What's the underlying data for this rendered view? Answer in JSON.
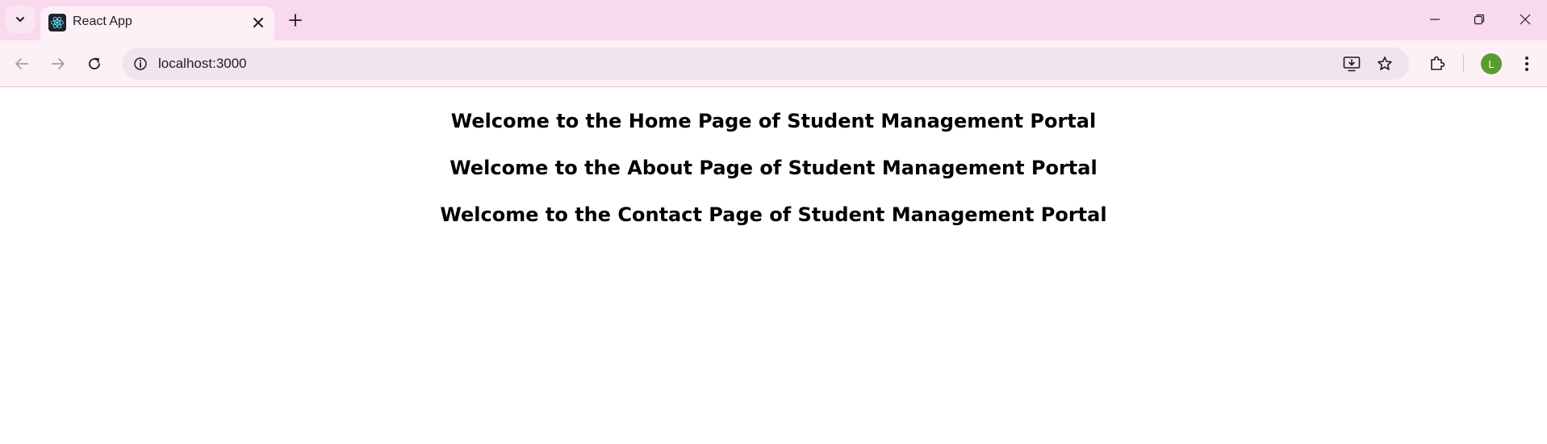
{
  "browser": {
    "tab": {
      "title": "React App"
    },
    "address_bar": {
      "url": "localhost:3000"
    },
    "profile_initial": "L",
    "colors": {
      "tab_strip": "#f8d9ee",
      "toolbar": "#fdf0f7",
      "omnibox": "#f1e4ee",
      "avatar": "#5b9b2f"
    },
    "icons": [
      "tab-search-chevron",
      "react-favicon",
      "close",
      "plus",
      "minimize",
      "restore",
      "close-window",
      "back-arrow",
      "forward-arrow",
      "reload",
      "site-info",
      "install-app",
      "star",
      "extensions",
      "more-vertical"
    ]
  },
  "page": {
    "headings": [
      "Welcome to the Home Page of Student Management Portal",
      "Welcome to the About Page of Student Management Portal",
      "Welcome to the Contact Page of Student Management Portal"
    ]
  }
}
